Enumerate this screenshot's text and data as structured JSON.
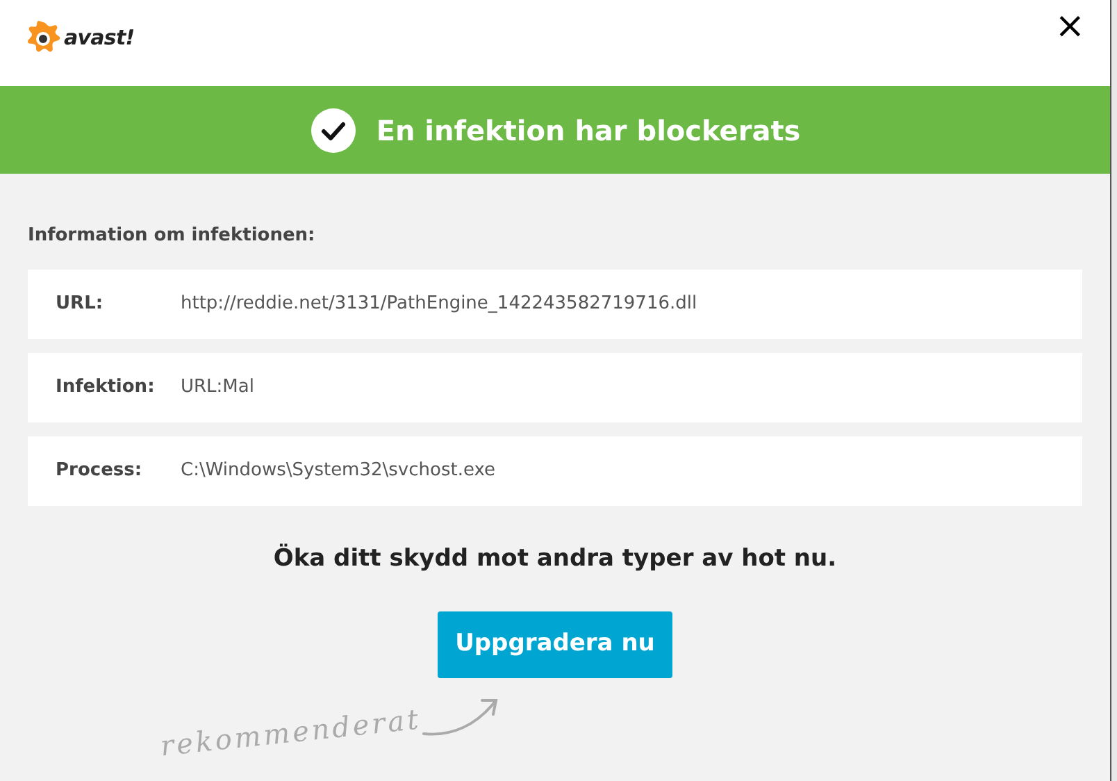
{
  "header": {
    "logo_text": "avast!",
    "close": "×"
  },
  "banner": {
    "title": "En infektion har blockerats"
  },
  "info": {
    "heading": "Information om infektionen:",
    "rows": [
      {
        "label": "URL:",
        "value": "http://reddie.net/3131/PathEngine_142243582719716.dll"
      },
      {
        "label": "Infektion:",
        "value": "URL:Mal"
      },
      {
        "label": "Process:",
        "value": "C:\\Windows\\System32\\svchost.exe"
      }
    ]
  },
  "promo": {
    "text": "Öka ditt skydd mot andra typer av hot nu.",
    "button": "Uppgradera nu",
    "note": "rekommenderat"
  }
}
